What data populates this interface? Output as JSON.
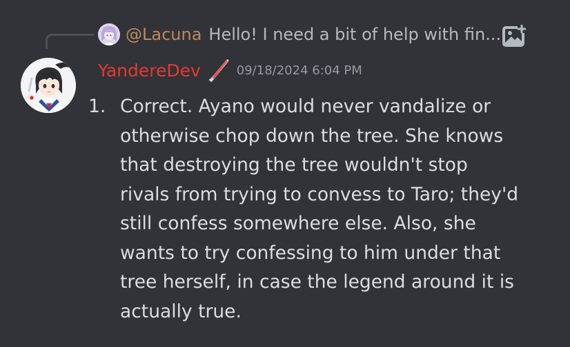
{
  "reply": {
    "author": "@Lacuna",
    "preview": "Hello! I need a bit of help with fin...",
    "attachment_icon": "image-icon"
  },
  "message": {
    "username": "YandereDev",
    "role_icon": "knife-icon",
    "timestamp": "09/18/2024 6:04 PM",
    "list_marker": "1.",
    "text": "Correct. Ayano would never vandalize or\notherwise chop down the tree. She knows\nthat destroying the tree wouldn't stop\nrivals from trying to convess to Taro; they'd\nstill confess somewhere else. Also, she\nwants to try confessing to him under that\ntree herself, in case the legend around it is\nactually true."
  },
  "colors": {
    "background": "#313338",
    "username": "#e8382f",
    "reply_author": "#c0875e",
    "text": "#dbdee1",
    "muted": "#949ba4"
  }
}
